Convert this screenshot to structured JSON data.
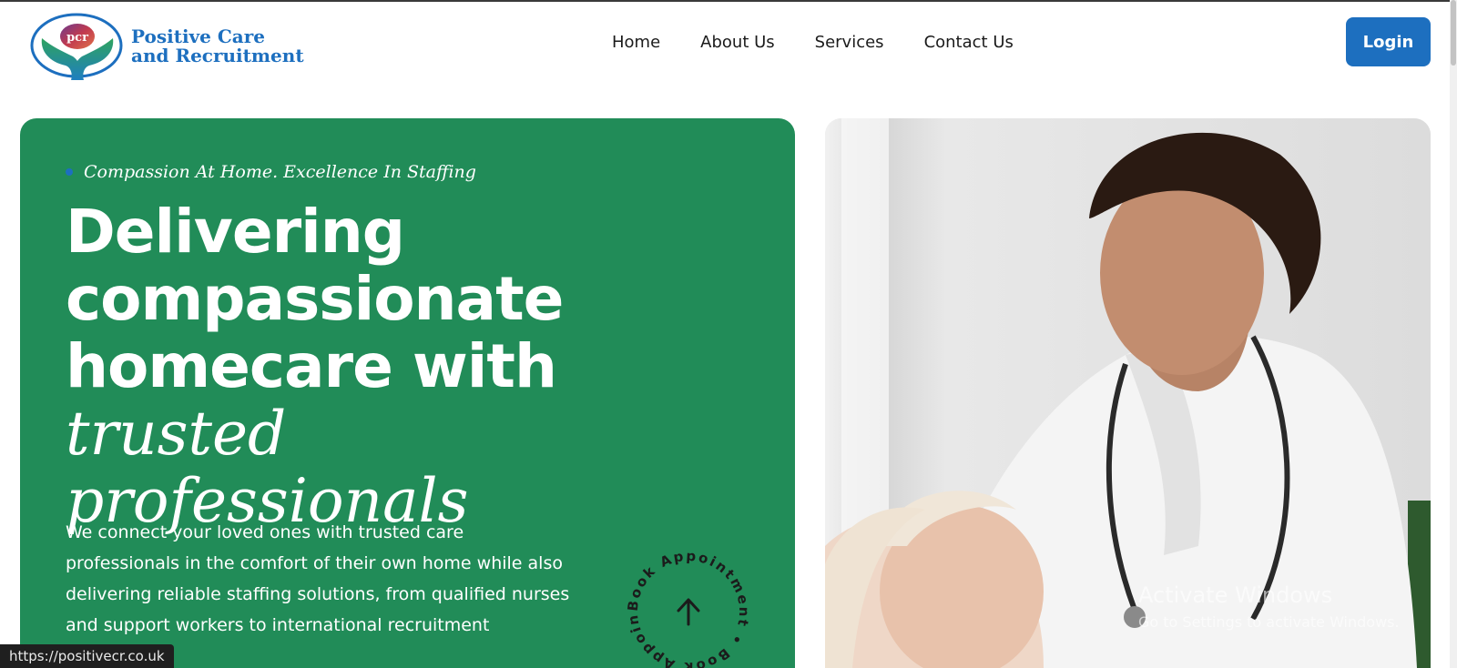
{
  "brand": {
    "mark_text": "pcr",
    "name_line1": "Positive Care",
    "name_line2": "and Recruitment",
    "color": "#1d6fbf"
  },
  "nav": {
    "items": [
      {
        "label": "Home"
      },
      {
        "label": "About Us"
      },
      {
        "label": "Services"
      },
      {
        "label": "Contact Us"
      }
    ],
    "login_label": "Login"
  },
  "hero": {
    "tagline": "Compassion At Home. Excellence In Staffing",
    "headline_plain_1": "Delivering",
    "headline_plain_2": "compassionate",
    "headline_plain_3": "homecare with",
    "headline_italic_1": "trusted",
    "headline_italic_2": "professionals",
    "paragraph": "We connect your loved ones with trusted care professionals in the comfort of their own home while also delivering reliable staffing solutions, from qualified nurses and support workers to international recruitment",
    "badge_text": "Book Appointment • Book Appointment •",
    "badge_icon": "arrow-up-icon",
    "background": "#218c58"
  },
  "watermark": {
    "line1": "Activate Windows",
    "line2": "Go to Settings to activate Windows."
  },
  "status_url": "https://positivecr.co.uk"
}
